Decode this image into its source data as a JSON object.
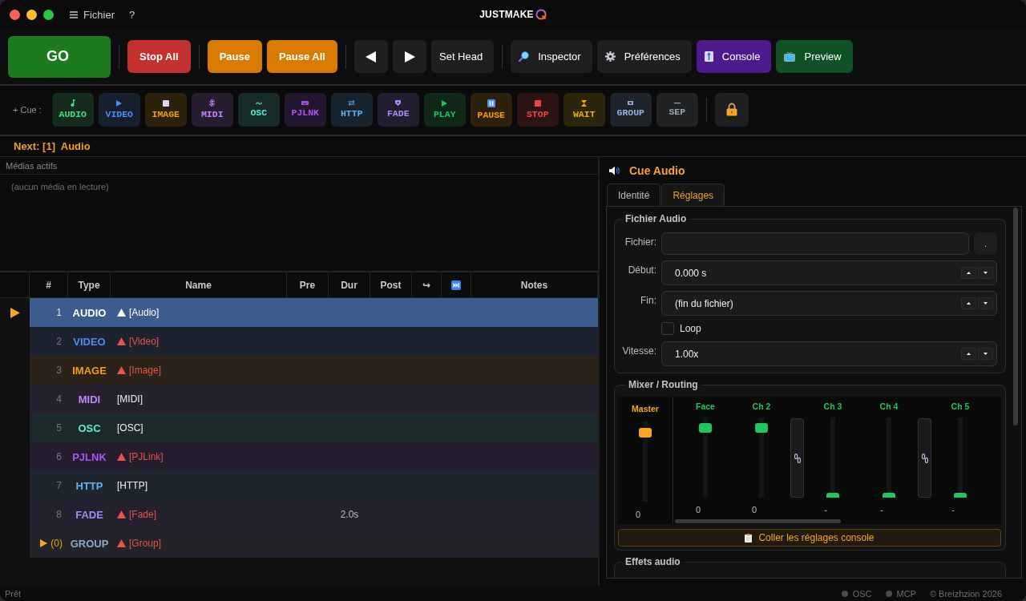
{
  "title_bar": {
    "menus": [
      {
        "label": "Fichier"
      },
      {
        "label": "?"
      }
    ],
    "logo": "JUSTMAKE"
  },
  "toolbar": {
    "groups": [
      [
        {
          "kind": "go",
          "label": "GO"
        }
      ],
      [
        {
          "kind": "danger",
          "label": "Stop All"
        }
      ],
      [
        {
          "kind": "warning",
          "label": "Pause"
        },
        {
          "kind": "warning",
          "label": "Pause All"
        }
      ],
      [
        {
          "kind": "prev"
        },
        {
          "kind": "next"
        },
        {
          "kind": "plain",
          "label": "Set Head"
        }
      ],
      [
        {
          "kind": "inspector",
          "label": "Inspector"
        },
        {
          "kind": "preferences",
          "label": "Préférences"
        },
        {
          "kind": "console",
          "label": "Console"
        },
        {
          "kind": "preview",
          "label": "Preview"
        }
      ]
    ]
  },
  "cue_bar": {
    "label": "+ Cue :",
    "buttons": [
      {
        "kind": "audio",
        "label": "AUDIO",
        "color": "#4ade80"
      },
      {
        "kind": "video",
        "label": "VIDEO",
        "color": "#4b8ef5"
      },
      {
        "kind": "image",
        "label": "IMAGE",
        "color": "#f59e0b"
      },
      {
        "kind": "midi",
        "label": "MIDI",
        "color": "#c084fc"
      },
      {
        "kind": "osc",
        "label": "OSC",
        "color": "#5eead4"
      },
      {
        "kind": "pjlink",
        "label": "PJLNK",
        "color": "#a855f7"
      },
      {
        "kind": "http",
        "label": "HTTP",
        "color": "#60b0f0"
      },
      {
        "kind": "fade",
        "label": "FADE",
        "color": "#a78bfa"
      },
      {
        "kind": "play",
        "label": "PLAY",
        "color": "#22c55e"
      },
      {
        "kind": "pause",
        "label": "PAUSE",
        "color": "#f59e0b"
      },
      {
        "kind": "stop",
        "label": "STOP",
        "color": "#ef4444"
      },
      {
        "kind": "wait",
        "label": "WAIT",
        "color": "#eab308"
      },
      {
        "kind": "group",
        "label": "GROUP",
        "color": "#8fb0d8"
      },
      {
        "kind": "separator",
        "label": "SEP",
        "color": "#9ca3af"
      }
    ],
    "lock": {
      "locked": true
    }
  },
  "next": "Next: [1]  Audio",
  "media": {
    "title": "Médias actifs",
    "empty": "(aucun média en lecture)"
  },
  "table": {
    "columns": [
      {
        "kind": "text",
        "label": "#"
      },
      {
        "kind": "text",
        "label": "Type"
      },
      {
        "kind": "text",
        "label": "Name"
      },
      {
        "kind": "text",
        "label": "Pre"
      },
      {
        "kind": "text",
        "label": "Dur"
      },
      {
        "kind": "text",
        "label": "Post"
      },
      {
        "kind": "text",
        "label": "↪"
      },
      {
        "kind": "icon"
      },
      {
        "kind": "text",
        "label": "Notes"
      }
    ],
    "rows": [
      {
        "kind": "cue",
        "number": "1",
        "type": "AUDIO",
        "name": "[Audio]",
        "warning": true,
        "selected": true,
        "playhead": true
      },
      {
        "kind": "cue",
        "number": "2",
        "type": "VIDEO",
        "color": "#4b8ef5",
        "name": "[Video]",
        "warning": true,
        "selected": false,
        "playhead": false
      },
      {
        "kind": "cue",
        "number": "3",
        "type": "IMAGE",
        "color": "#f59e0b",
        "name": "[Image]",
        "warning": true,
        "selected": false,
        "playhead": false
      },
      {
        "kind": "cue",
        "number": "4",
        "type": "MIDI",
        "color": "#c084fc",
        "name": "[MIDI]",
        "warning": false,
        "selected": false,
        "playhead": false
      },
      {
        "kind": "cue",
        "number": "5",
        "type": "OSC",
        "color": "#5eead4",
        "name": "[OSC]",
        "warning": false,
        "selected": false,
        "playhead": false
      },
      {
        "kind": "cue",
        "number": "6",
        "type": "PJLNK",
        "color": "#a855f7",
        "name": "[PJLink]",
        "warning": true,
        "selected": false,
        "playhead": false
      },
      {
        "kind": "cue",
        "number": "7",
        "type": "HTTP",
        "color": "#60b0f0",
        "name": "[HTTP]",
        "warning": false,
        "selected": false,
        "playhead": false
      },
      {
        "kind": "cue",
        "number": "8",
        "type": "FADE",
        "color": "#a78bfa",
        "name": "[Fade]",
        "dur": "2.0s",
        "warning": true,
        "selected": false,
        "playhead": false
      },
      {
        "kind": "group",
        "count": "(0)",
        "expanded": false,
        "type": "GROUP",
        "color": "#8fa8c8",
        "name": "[Group]",
        "warning": true,
        "selected": false,
        "playhead": false
      }
    ]
  },
  "inspector": {
    "title": "Cue Audio",
    "tabs": [
      {
        "label": "Identité",
        "selected": false
      },
      {
        "label": "Réglages",
        "selected": true
      }
    ],
    "file_section": {
      "title": "Fichier Audio",
      "fields": [
        {
          "kind": "file",
          "label": "Fichier:",
          "button": "."
        },
        {
          "kind": "spin",
          "label": "Début:",
          "value": "0.000 s"
        },
        {
          "kind": "spin",
          "label": "Fin:",
          "value": "(fin du fichier)"
        },
        {
          "kind": "checkbox",
          "label": "Loop",
          "checked": false
        },
        {
          "kind": "spin",
          "label": "Vitesse:",
          "value": "1.00x"
        }
      ]
    },
    "mixer": {
      "title": "Mixer / Routing",
      "master": {
        "label": "Master",
        "level": 0.92,
        "reading": "0"
      },
      "strips": [
        {
          "kind": "fader",
          "label": "Face",
          "level": 0.93,
          "reading": "0"
        },
        {
          "kind": "fader",
          "label": "Ch 2",
          "level": 0.93,
          "reading": "0"
        },
        {
          "kind": "link"
        },
        {
          "kind": "fader",
          "label": "Ch 3",
          "level": 0,
          "reading": "-"
        },
        {
          "kind": "fader",
          "label": "Ch 4",
          "level": 0,
          "reading": "-"
        },
        {
          "kind": "link"
        },
        {
          "kind": "fader",
          "label": "Ch 5",
          "level": 0,
          "reading": "-"
        }
      ],
      "paste_button": "Coller les réglages console"
    },
    "effects_section": {
      "title": "Effets audio"
    }
  },
  "status_bar": {
    "text": "Prêt",
    "indicators": [
      {
        "label": "OSC",
        "on": false
      },
      {
        "label": "MCP",
        "on": false
      }
    ],
    "copyright": "© Breizhzion 2026"
  }
}
